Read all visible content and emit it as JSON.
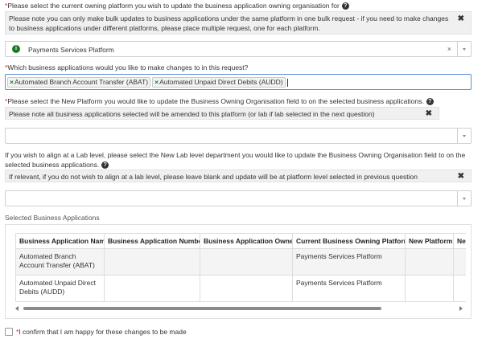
{
  "q1": {
    "label": "Please select the current owning platform you wish to update the business application owning organisation for",
    "note": "Please note you can only make bulk updates to business applications under the same platform in one bulk request - if you need to make changes to business applications under different platforms, please place multiple request, one for each platform.",
    "value": "Payments Services Platform"
  },
  "q2": {
    "label": "Which business applications would you like to make changes to in this request?",
    "tags": [
      "Automated Branch Account Transfer (ABAT)",
      "Automated Unpaid Direct Debits (AUDD)"
    ]
  },
  "q3": {
    "label": "Please select the New Platform you would like to update the Business Owning Organisation field to on the selected business applications.",
    "note": "Please note all business applications selected will be amended to this platform (or lab if lab selected in the next question)",
    "value": ""
  },
  "q4": {
    "label": "If you wish to align at a Lab level, please select the New Lab level department you would like to update the Business Owning Organisation field to on the selected business applications.",
    "note": "If relevant, if you do not wish to align at a lab level, please leave blank and update will be at platform level selected in previous question",
    "value": ""
  },
  "table": {
    "title": "Selected Business Applications",
    "columns": [
      "Business Application Name",
      "Business Application Number",
      "Business Application Owner",
      "Current Business Owning Platform",
      "New Platform",
      "Ne"
    ],
    "rows": [
      [
        "Automated Branch Account Transfer (ABAT)",
        "",
        "",
        "Payments Services Platform",
        "",
        ""
      ],
      [
        "Automated Unpaid Direct Debits (AUDD)",
        "",
        "",
        "Payments Services Platform",
        "",
        ""
      ]
    ]
  },
  "confirm": {
    "label": "I confirm that I am happy for these changes to be made"
  },
  "colors": {
    "required": "#c9302c",
    "tagX": "#1a7a2a",
    "noteBg": "#f0f0f0"
  }
}
